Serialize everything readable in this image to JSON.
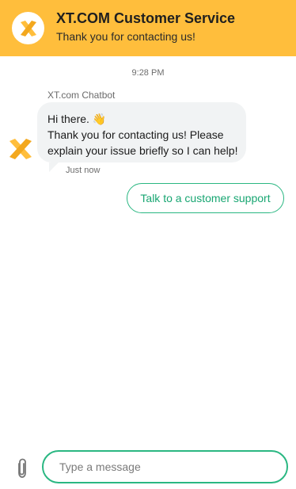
{
  "header": {
    "title": "XT.COM Customer Service",
    "subtitle": "Thank you for contacting us!",
    "logo_icon": "xt-logo-icon"
  },
  "conversation": {
    "timestamp": "9:28 PM",
    "messages": [
      {
        "sender": "XT.com Chatbot",
        "avatar_icon": "xt-logo-icon",
        "lines": [
          "Hi there. 👋",
          "Thank you for contacting us! Please",
          "explain your issue briefly so I can help!"
        ],
        "sent_label": "Just now"
      }
    ],
    "quick_replies": [
      "Talk to a customer support"
    ]
  },
  "composer": {
    "attach_icon": "paperclip-icon",
    "placeholder": "Type a message",
    "value": ""
  },
  "colors": {
    "brand_yellow": "#ffbe3c",
    "accent_green": "#2ab782",
    "bubble_bg": "#f1f3f4"
  }
}
